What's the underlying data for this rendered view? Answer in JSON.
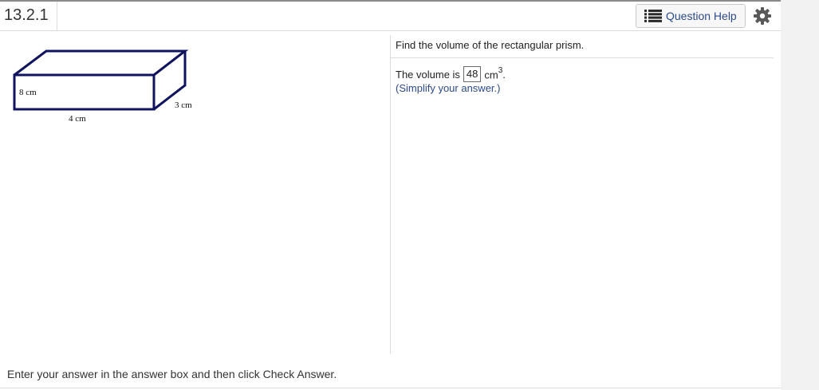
{
  "header": {
    "question_number": "13.2.1",
    "help_label": "Question Help",
    "help_icon": "list-icon",
    "settings_icon": "gear-icon"
  },
  "figure": {
    "dimensions": {
      "height": "8 cm",
      "width": "4 cm",
      "depth": "3 cm"
    },
    "stroke_color": "#10135e"
  },
  "question": {
    "prompt": "Find the volume of the rectangular prism.",
    "answer_prefix": "The volume is",
    "answer_value": "48",
    "answer_unit": "cm",
    "answer_unit_exponent": "3",
    "answer_suffix": ".",
    "hint": "(Simplify your answer.)"
  },
  "footer": {
    "message": "Enter your answer in the answer box and then click Check Answer."
  }
}
